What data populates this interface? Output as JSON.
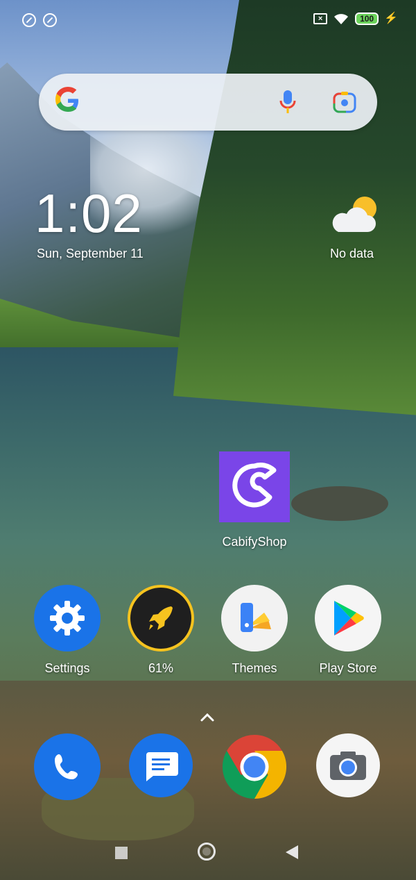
{
  "status_bar": {
    "battery_level": "100",
    "charging_icon": "bolt-icon"
  },
  "search_bar": {
    "logo": "google-g-icon",
    "mic": "microphone-icon",
    "lens": "google-lens-icon"
  },
  "clock": {
    "time": "1:02",
    "date": "Sun, September 11"
  },
  "weather": {
    "icon": "partly-cloudy-icon",
    "text": "No data"
  },
  "home_apps": [
    {
      "label": "CabifyShop"
    }
  ],
  "row_apps": [
    {
      "label": "Settings"
    },
    {
      "label": "61%"
    },
    {
      "label": "Themes"
    },
    {
      "label": "Play Store"
    }
  ],
  "dock": [
    {
      "name": "Phone"
    },
    {
      "name": "Messages"
    },
    {
      "name": "Chrome"
    },
    {
      "name": "Camera"
    }
  ],
  "colors": {
    "cabify_purple": "#7a45e8",
    "settings_blue": "#1a73e8",
    "battery_green": "#6bd35b",
    "booster_yellow": "#f6c31f"
  }
}
